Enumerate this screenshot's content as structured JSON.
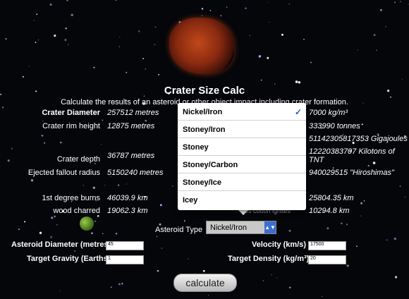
{
  "header": {
    "title": "Crater Size Calc",
    "description": "Calculate the results of an asteroid or other object impact including crater formation."
  },
  "results_left": [
    {
      "label": "Crater Diameter",
      "value": "257512 metres"
    },
    {
      "label": "Crater rim height",
      "value": "12875 metres"
    },
    {
      "label": "Crater depth",
      "value": "36787 metres"
    },
    {
      "label": "Ejected fallout radius",
      "value": "5150240 metres"
    },
    {
      "label": "1st degree burns",
      "value": "46039.9 km"
    },
    {
      "label": "wood charred",
      "value": "19062.3 km"
    }
  ],
  "results_right": [
    {
      "value": "7000 kg/m³"
    },
    {
      "value": "333990 tonnes"
    },
    {
      "value": "51142305817353 Gigajoules"
    },
    {
      "value": "12220383707 Kilotons of TNT"
    },
    {
      "value": "940029515 \"Hiroshimas\""
    },
    {
      "value": "25804.35 km"
    },
    {
      "label": "es cotton ignites",
      "value": "10294.8 km"
    }
  ],
  "asteroid_type": {
    "label": "Asteroid Type",
    "selected": "Nickel/Iron",
    "options": [
      "Nickel/Iron",
      "Stoney/Iron",
      "Stoney",
      "Stoney/Carbon",
      "Stoney/Ice",
      "Icey"
    ],
    "check_glyph": "✓"
  },
  "inputs": {
    "asteroid_diameter": {
      "label": "Asteroid Diameter",
      "unit": "(metres)",
      "value": "45"
    },
    "target_gravity": {
      "label": "Target Gravity",
      "unit": "(Earths)",
      "value": "1"
    },
    "velocity": {
      "label": "Velocity",
      "unit": "(km/s)",
      "value": "17500"
    },
    "target_density": {
      "label": "Target Density",
      "unit": "(kg/m³)",
      "value": "20"
    }
  },
  "calculate_label": "calculate",
  "colors": {
    "accent_blue": "#3a6fd2",
    "check_blue": "#1f5ecc",
    "background": "#05060a"
  },
  "icons": {
    "select_arrow": "▲▼"
  }
}
